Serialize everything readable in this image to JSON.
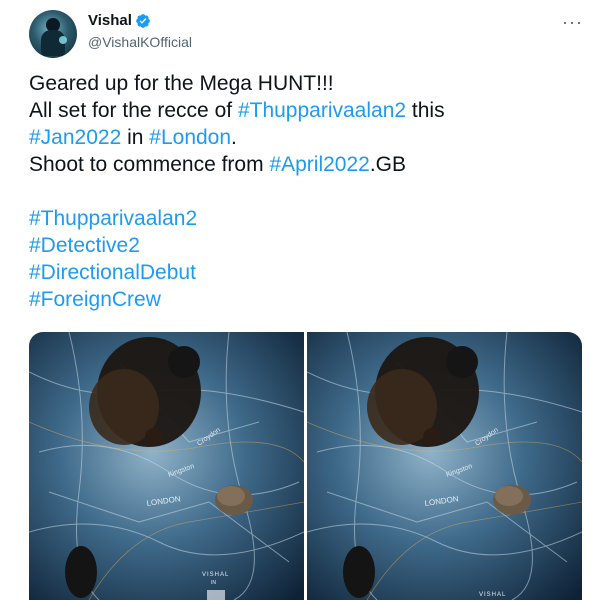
{
  "author": {
    "name": "Vishal",
    "handle": "@VishalKOfficial",
    "verified": true,
    "avatar_icon": "profile-avatar",
    "verified_icon": "verified-badge-icon"
  },
  "more_icon": "more-horizontal-icon",
  "more_label": "···",
  "tweet": {
    "line1": "Geared up for the Mega HUNT!!!",
    "line2_prefix": "All set for the recce of ",
    "line2_tag": "#Thupparivaalan2",
    "line2_suffix": " this",
    "line3_tag1": "#Jan2022",
    "line3_mid": " in ",
    "line3_tag2": "#London",
    "line3_suffix": ".",
    "line4_prefix": "Shoot to commence from ",
    "line4_tag": "#April2022",
    "line4_suffix": ".GB",
    "hashtags": [
      "#Thupparivaalan2",
      "#Detective2",
      "#DirectionalDebut",
      "#ForeignCrew"
    ]
  },
  "media": {
    "images": [
      {
        "name": "poster-left",
        "caption": "VISHAL",
        "caption2": "IN"
      },
      {
        "name": "poster-right",
        "caption": "VISHAL"
      }
    ],
    "map_text": {
      "london": "LONDON",
      "croydon": "Croydon",
      "kingston": "Kingston"
    }
  },
  "colors": {
    "link": "#1d9bf0",
    "text": "#0f1419",
    "secondary": "#536471",
    "verified": "#1d9bf0"
  }
}
